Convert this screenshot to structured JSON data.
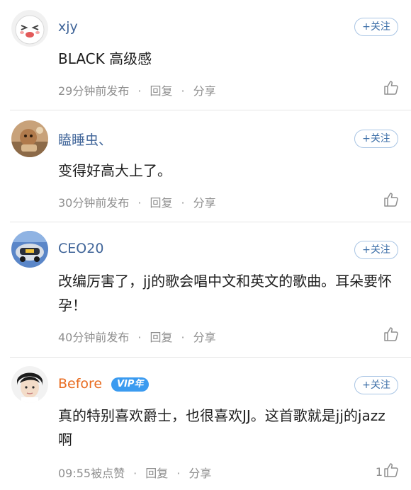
{
  "follow_label": "+关注",
  "comments": [
    {
      "username": "xjy",
      "text": "BLACK 高级感",
      "time": "29分钟前发布",
      "reply": "回复",
      "share": "分享",
      "likes": ""
    },
    {
      "username": "瞌睡虫、",
      "text": "变得好高大上了。",
      "time": "30分钟前发布",
      "reply": "回复",
      "share": "分享",
      "likes": ""
    },
    {
      "username": "CEO20",
      "text": "改编厉害了，jj的歌会唱中文和英文的歌曲。耳朵要怀孕！",
      "time": "40分钟前发布",
      "reply": "回复",
      "share": "分享",
      "likes": ""
    },
    {
      "username": "Before",
      "vip_badge": "VIP年",
      "text": "真的特别喜欢爵士，也很喜欢JJ。这首歌就是jj的jazz啊",
      "time": "09:55被点赞",
      "reply": "回复",
      "share": "分享",
      "likes": "1"
    }
  ],
  "separator": "·",
  "icons": {
    "like": "thumbs-up-icon"
  },
  "colors": {
    "username": "#406599",
    "vip_username": "#e86b1f",
    "vip_badge": "#3b9bf0",
    "follow_border": "#a9c5e4",
    "meta": "#8f8f8f"
  }
}
